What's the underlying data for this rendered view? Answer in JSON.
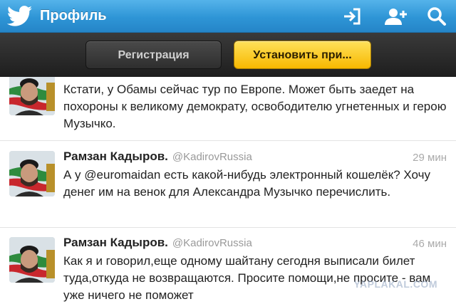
{
  "header": {
    "title": "Профиль",
    "icons": [
      "twitter-bird-icon",
      "sign-in-icon",
      "add-user-icon",
      "search-icon"
    ],
    "bg_color": "#2e95d6"
  },
  "actions": {
    "register_label": "Регистрация",
    "install_label": "Установить при...",
    "install_color": "#f7b800"
  },
  "tweets": [
    {
      "name": "",
      "handle": "",
      "time": "",
      "text": "Кстати, у Обамы сейчас тур по Европе. Может быть заедет на похороны к великому демократу, освободителю угнетенных и герою Музычко."
    },
    {
      "name": "Рамзан Кадыров.",
      "handle": "@KadirovRussia",
      "time": "29 мин",
      "text": "А у @euromaidan есть какой-нибудь электронный кошелёк? Хочу денег им на венок для Александра Музычко перечислить."
    },
    {
      "name": "Рамзан Кадыров.",
      "handle": "@KadirovRussia",
      "time": "46 мин",
      "text": "Как я и говорил,еще одному шайтану сегодня выписали билет туда,откуда не возвращаются. Просите помощи,не просите - вам уже ничего не поможет"
    }
  ],
  "watermark": "YAPLAKAL.COM"
}
